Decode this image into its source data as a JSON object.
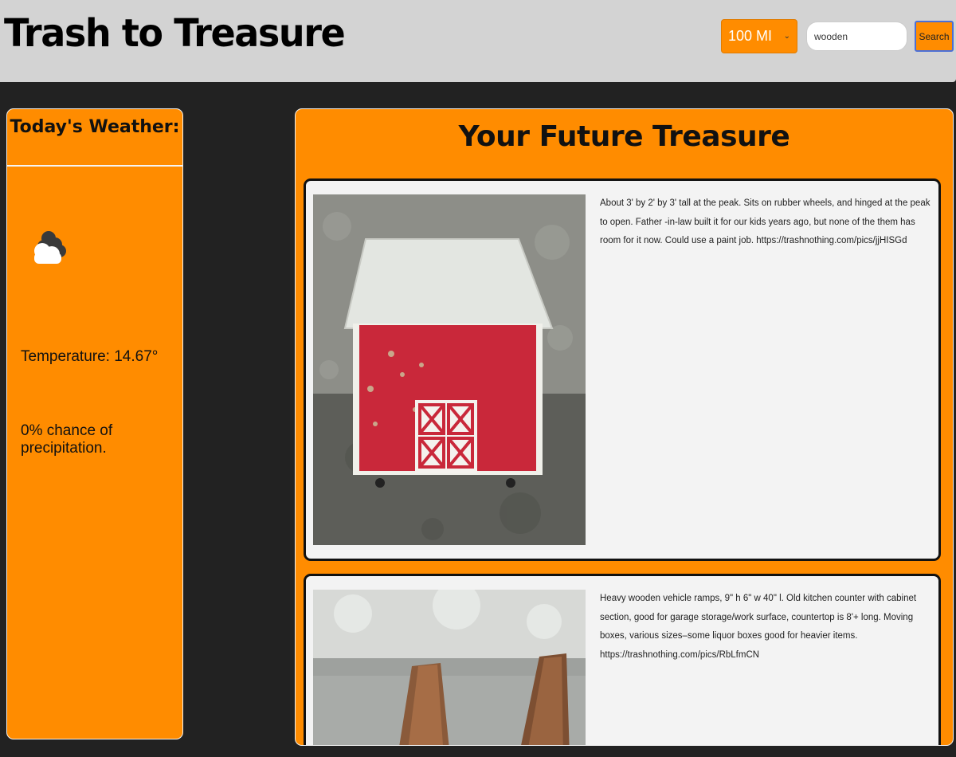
{
  "header": {
    "brand": "Trash to Treasure",
    "range_select": {
      "selected": "100 MI"
    },
    "search": {
      "value": "wooden",
      "placeholder": ""
    },
    "search_button": "Search"
  },
  "weather": {
    "title": "Today's Weather:",
    "icon": "cloudy-icon",
    "temperature": "Temperature: 14.67°",
    "precipitation": "0% chance of precipitation."
  },
  "results": {
    "title": "Your Future Treasure",
    "items": [
      {
        "description": "About 3' by 2' by 3' tall at the peak. Sits on rubber wheels, and hinged at the peak to open. Father -in-law built it for our kids years ago, but none of the them has room for it now. Could use a paint job.",
        "link": "https://trashnothing.com/pics/jjHISGd",
        "photo": "red-barn-toy-chest"
      },
      {
        "description": "Heavy wooden vehicle ramps, 9\" h 6\" w 40\" l. Old kitchen counter with cabinet section, good for garage storage/work surface, countertop is 8'+ long. Moving boxes, various sizes–some liquor boxes good for heavier items.",
        "link": "https://trashnothing.com/pics/RbLfmCN",
        "photo": "wooden-vehicle-ramps"
      }
    ]
  },
  "colors": {
    "accent": "#ff8c00",
    "header_bg": "#d3d3d3",
    "page_bg": "#222222",
    "card_bg": "#f3f3f3",
    "search_button_border": "#4a6fd8"
  }
}
